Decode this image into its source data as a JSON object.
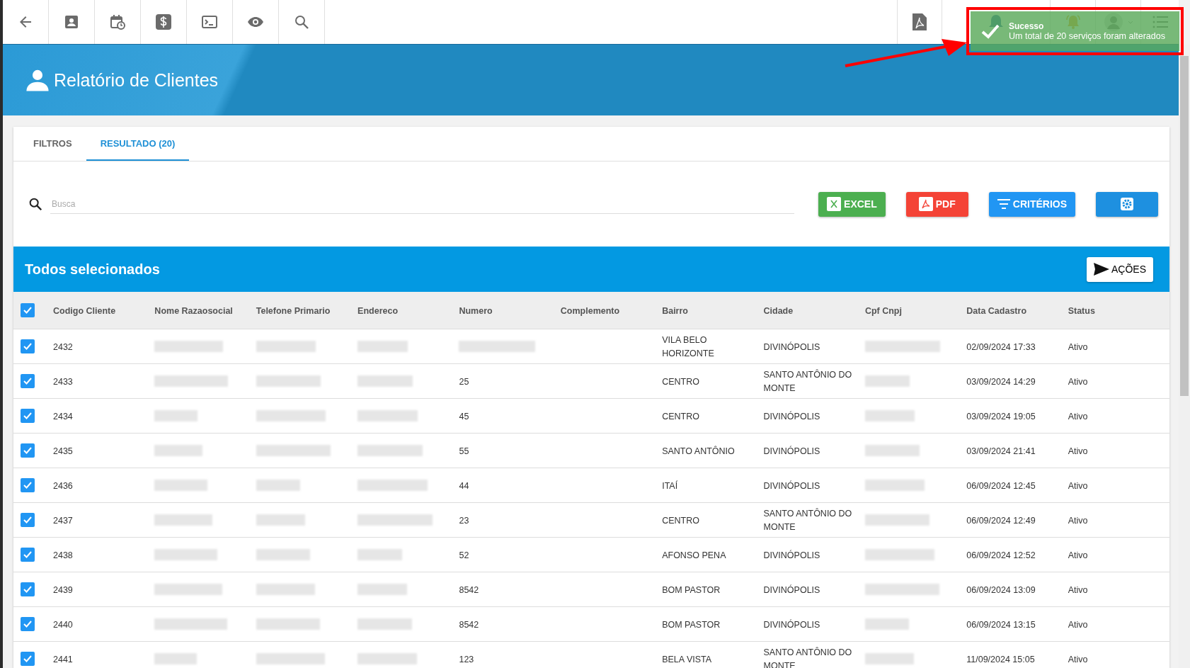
{
  "toast": {
    "title": "Sucesso",
    "message": "Um total de 20 serviços foram alterados"
  },
  "banner": {
    "title": "Relatório de Clientes"
  },
  "tabs": [
    {
      "label": "FILTROS",
      "selected": false
    },
    {
      "label": "RESULTADO (20)",
      "selected": true
    }
  ],
  "search": {
    "placeholder": "Busca"
  },
  "buttons": [
    {
      "kind": "excel",
      "label": "EXCEL"
    },
    {
      "kind": "pdf",
      "label": "PDF"
    },
    {
      "kind": "criterios",
      "label": "CRITÉRIOS"
    },
    {
      "kind": "settings"
    }
  ],
  "selection_bar": {
    "title": "Todos selecionados",
    "action": "AÇÕES"
  },
  "table": {
    "all_checked": true,
    "columns": [
      "Codigo Cliente",
      "Nome Razaosocial",
      "Telefone Primario",
      "Endereco",
      "Numero",
      "Complemento",
      "Bairro",
      "Cidade",
      "Cpf Cnpj",
      "Data Cadastro",
      "Status"
    ],
    "rows": [
      {
        "checked": true,
        "cells": [
          "2432",
          {
            "kind": "redacted"
          },
          {
            "kind": "redacted"
          },
          {
            "kind": "redacted"
          },
          {
            "kind": "redacted"
          },
          "",
          "VILA BELO HORIZONTE",
          "DIVINÓPOLIS",
          {
            "kind": "redacted"
          },
          "02/09/2024 17:33",
          "Ativo"
        ]
      },
      {
        "checked": true,
        "cells": [
          "2433",
          {
            "kind": "redacted"
          },
          {
            "kind": "redacted"
          },
          {
            "kind": "redacted"
          },
          "25",
          "",
          "CENTRO",
          "SANTO ANTÔNIO DO MONTE",
          {
            "kind": "redacted"
          },
          "03/09/2024 14:29",
          "Ativo"
        ]
      },
      {
        "checked": true,
        "cells": [
          "2434",
          {
            "kind": "redacted"
          },
          {
            "kind": "redacted"
          },
          {
            "kind": "redacted"
          },
          "45",
          "",
          "CENTRO",
          "DIVINÓPOLIS",
          {
            "kind": "redacted"
          },
          "03/09/2024 19:05",
          "Ativo"
        ]
      },
      {
        "checked": true,
        "cells": [
          "2435",
          {
            "kind": "redacted"
          },
          {
            "kind": "redacted"
          },
          {
            "kind": "redacted"
          },
          "55",
          "",
          "SANTO ANTÔNIO",
          "DIVINÓPOLIS",
          {
            "kind": "redacted"
          },
          "03/09/2024 21:41",
          "Ativo"
        ]
      },
      {
        "checked": true,
        "cells": [
          "2436",
          {
            "kind": "redacted"
          },
          {
            "kind": "redacted"
          },
          {
            "kind": "redacted"
          },
          "44",
          "",
          "ITAÍ",
          "DIVINÓPOLIS",
          {
            "kind": "redacted"
          },
          "06/09/2024 12:45",
          "Ativo"
        ]
      },
      {
        "checked": true,
        "cells": [
          "2437",
          {
            "kind": "redacted"
          },
          {
            "kind": "redacted"
          },
          {
            "kind": "redacted"
          },
          "23",
          "",
          "CENTRO",
          "SANTO ANTÔNIO DO MONTE",
          {
            "kind": "redacted"
          },
          "06/09/2024 12:49",
          "Ativo"
        ]
      },
      {
        "checked": true,
        "cells": [
          "2438",
          {
            "kind": "redacted"
          },
          {
            "kind": "redacted"
          },
          {
            "kind": "redacted"
          },
          "52",
          "",
          "AFONSO PENA",
          "DIVINÓPOLIS",
          {
            "kind": "redacted"
          },
          "06/09/2024 12:52",
          "Ativo"
        ]
      },
      {
        "checked": true,
        "cells": [
          "2439",
          {
            "kind": "redacted"
          },
          {
            "kind": "redacted"
          },
          {
            "kind": "redacted"
          },
          "8542",
          "",
          "BOM PASTOR",
          "DIVINÓPOLIS",
          {
            "kind": "redacted"
          },
          "06/09/2024 13:09",
          "Ativo"
        ]
      },
      {
        "checked": true,
        "cells": [
          "2440",
          {
            "kind": "redacted"
          },
          {
            "kind": "redacted"
          },
          {
            "kind": "redacted"
          },
          "8542",
          "",
          "BOM PASTOR",
          "DIVINÓPOLIS",
          {
            "kind": "redacted"
          },
          "06/09/2024 13:15",
          "Ativo"
        ]
      },
      {
        "checked": true,
        "cells": [
          "2441",
          {
            "kind": "redacted"
          },
          {
            "kind": "redacted"
          },
          {
            "kind": "redacted"
          },
          "123",
          "",
          "BELA VISTA",
          "SANTO ANTÔNIO DO MONTE",
          {
            "kind": "redacted"
          },
          "11/09/2024 15:05",
          "Ativo"
        ]
      }
    ]
  }
}
